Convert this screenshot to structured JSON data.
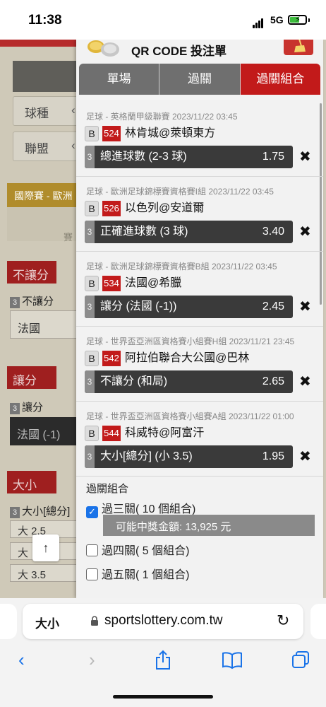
{
  "status_bar": {
    "time": "11:38",
    "network": "5G"
  },
  "background_page": {
    "selects": [
      {
        "label": "球種",
        "arrow": "‹"
      },
      {
        "label": "聯盟",
        "arrow": "‹"
      }
    ],
    "banner": "國際賽 - 歐洲",
    "banner_sub": "賽",
    "sections": [
      {
        "title": "不讓分",
        "row_num": "3",
        "row_label": "不讓分",
        "value": "法國"
      },
      {
        "title": "讓分",
        "row_num": "3",
        "row_label": "讓分",
        "value": "法國 (-1)"
      },
      {
        "title": "大小",
        "row_num": "3",
        "row_label": "大小[總分]"
      }
    ],
    "sizes": [
      "大 2.5",
      "大",
      "大 3.5"
    ],
    "scroll_top": "↑"
  },
  "panel": {
    "title": "QR CODE 投注單",
    "tabs": [
      "單場",
      "過關",
      "過關組合"
    ],
    "active_tab": 2,
    "bets": [
      {
        "meta": "足球 - 英格蘭甲級聯賽 2023/11/22 03:45",
        "badge": "B",
        "number": "524",
        "teams": "林肯城@萊頓東方",
        "idx": "3",
        "pick": "總進球數 (2-3 球)",
        "odds": "1.75"
      },
      {
        "meta": "足球 - 歐洲足球錦標賽資格賽I組 2023/11/22 03:45",
        "badge": "B",
        "number": "526",
        "teams": "以色列@安道爾",
        "idx": "3",
        "pick": "正確進球數 (3 球)",
        "odds": "3.40"
      },
      {
        "meta": "足球 - 歐洲足球錦標賽資格賽B組 2023/11/22 03:45",
        "badge": "B",
        "number": "534",
        "teams": "法國@希臘",
        "idx": "3",
        "pick": "讓分 (法國 (-1))",
        "odds": "2.45"
      },
      {
        "meta": "足球 - 世界盃亞洲區資格賽小組賽H組 2023/11/21 23:45",
        "badge": "B",
        "number": "542",
        "teams": "阿拉伯聯合大公國@巴林",
        "idx": "3",
        "pick": "不讓分 (和局)",
        "odds": "2.65"
      },
      {
        "meta": "足球 - 世界盃亞洲區資格賽小組賽A組 2023/11/22 01:00",
        "badge": "B",
        "number": "544",
        "teams": "科威特@阿富汗",
        "idx": "3",
        "pick": "大小[總分] (小 3.5)",
        "odds": "1.95"
      }
    ],
    "remove_icon": "✖",
    "combo": {
      "title": "過關組合",
      "options": [
        {
          "label": "過三關( 10 個組合)",
          "checked": true
        },
        {
          "label": "過四關( 5 個組合)",
          "checked": false
        },
        {
          "label": "過五關( 1 個組合)",
          "checked": false
        }
      ],
      "prize_text": "可能中獎金額: 13,925 元"
    }
  },
  "browser": {
    "aa_label": "大小",
    "url": "sportslottery.com.tw",
    "reload_icon": "↻",
    "nav": [
      "‹",
      "›",
      "share-icon",
      "book-icon",
      "tabs-icon"
    ]
  },
  "colors": {
    "brand_red": "#c21a1a",
    "tab_gray": "#6f6f6f",
    "check_blue": "#1a73e8"
  }
}
